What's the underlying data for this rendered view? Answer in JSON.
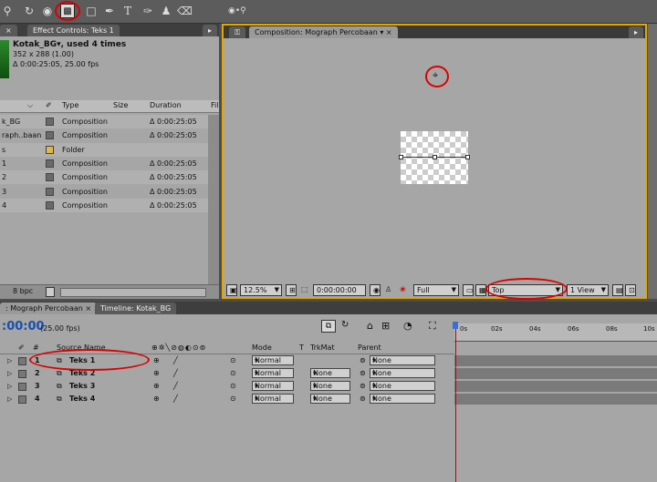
{
  "toolbar": {
    "tools": [
      "zoom-tool-icon",
      "rotate-tool-icon",
      "orbit-camera-icon",
      "pan-behind-icon",
      "mask-rect-icon",
      "pen-tool-icon",
      "type-tool-icon",
      "brush-tool-icon",
      "clone-stamp-icon",
      "eraser-tool-icon"
    ]
  },
  "project_panel": {
    "tab": "Effect Controls: Teks 1",
    "item_name": "Kotak_BG▾, used 4 times",
    "item_size": "352 x 288 (1.00)",
    "item_duration": "Δ 0:00:25:05, 25.00 fps",
    "columns": {
      "type": "Type",
      "size": "Size",
      "duration": "Duration",
      "file": "Fil"
    },
    "rows": [
      {
        "name": "k_BG",
        "type": "Composition",
        "duration": "Δ 0:00:25:05",
        "swatch": "#6a6a6a"
      },
      {
        "name": "raph..baan",
        "type": "Composition",
        "duration": "Δ 0:00:25:05",
        "swatch": "#6a6a6a"
      },
      {
        "name": "s",
        "type": "Folder",
        "duration": "",
        "swatch": "#e0b84a"
      },
      {
        "name": "1",
        "type": "Composition",
        "duration": "Δ 0:00:25:05",
        "swatch": "#6a6a6a"
      },
      {
        "name": "2",
        "type": "Composition",
        "duration": "Δ 0:00:25:05",
        "swatch": "#6a6a6a"
      },
      {
        "name": "3",
        "type": "Composition",
        "duration": "Δ 0:00:25:05",
        "swatch": "#6a6a6a"
      },
      {
        "name": "4",
        "type": "Composition",
        "duration": "Δ 0:00:25:05",
        "swatch": "#6a6a6a"
      }
    ],
    "bpc": "8 bpc"
  },
  "viewer": {
    "tab": "Composition: Mograph Percobaan",
    "zoom": "12.5%",
    "timecode": "0:00:00:00",
    "resolution": "Full",
    "view": "Top",
    "view_count": "1 View"
  },
  "timeline": {
    "tabs": [
      ": Mograph Percobaan",
      "Timeline: Kotak_BG"
    ],
    "current_time": ":00:00",
    "fps": "(25.00 fps)",
    "headers": {
      "num": "#",
      "source": "Source Name",
      "mode": "Mode",
      "t": "T",
      "trkmat": "TrkMat",
      "parent": "Parent"
    },
    "ruler": [
      "0s",
      "02s",
      "04s",
      "06s",
      "08s",
      "10s"
    ],
    "layers": [
      {
        "num": "1",
        "name": "Teks 1",
        "mode": "Normal",
        "trkmat": "",
        "parent": "None"
      },
      {
        "num": "2",
        "name": "Teks 2",
        "mode": "Normal",
        "trkmat": "None",
        "parent": "None"
      },
      {
        "num": "3",
        "name": "Teks 3",
        "mode": "Normal",
        "trkmat": "None",
        "parent": "None"
      },
      {
        "num": "4",
        "name": "Teks 4",
        "mode": "Normal",
        "trkmat": "None",
        "parent": "None"
      }
    ]
  },
  "colors": {
    "highlight": "#d00000",
    "active_panel": "#e0a800",
    "playhead": "#c00000"
  }
}
